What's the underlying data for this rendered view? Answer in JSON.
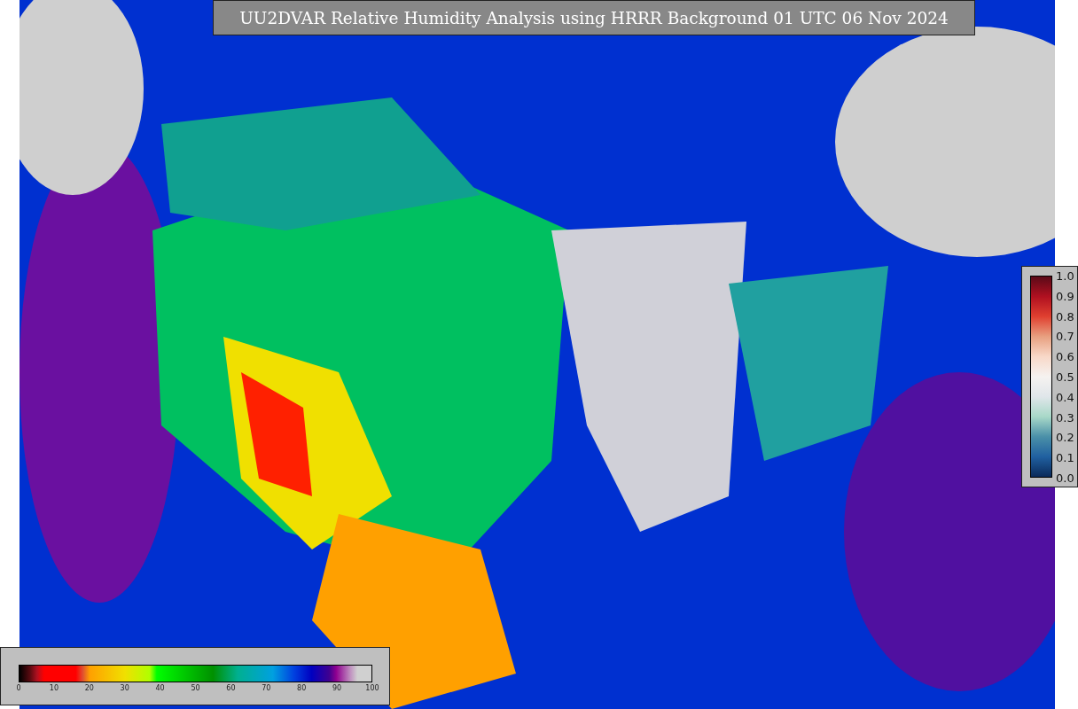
{
  "title": "UU2DVAR Relative Humidity Analysis using HRRR Background 01 UTC 06 Nov 2024",
  "observation_colorbar": {
    "ticks": [
      "1.0",
      "0.9",
      "0.8",
      "0.7",
      "0.6",
      "0.5",
      "0.4",
      "0.3",
      "0.2",
      "0.1",
      "0.0"
    ]
  },
  "humidity_colorbar": {
    "ticks": [
      "0",
      "10",
      "20",
      "30",
      "40",
      "50",
      "60",
      "70",
      "80",
      "90",
      "100"
    ]
  }
}
